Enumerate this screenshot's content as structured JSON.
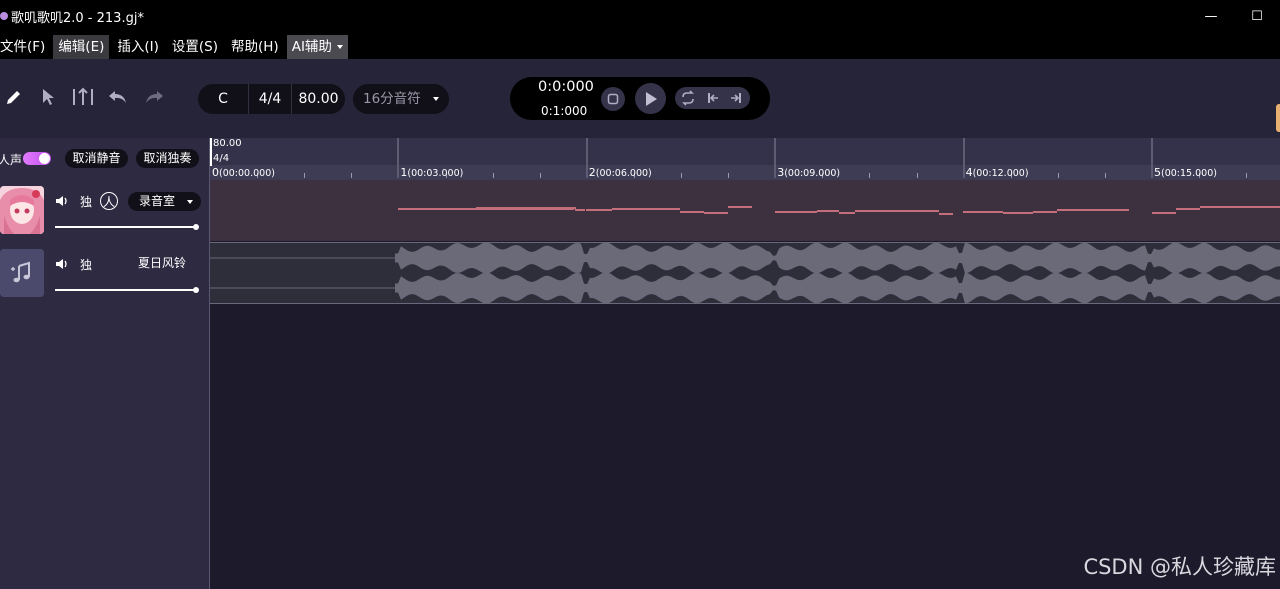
{
  "window": {
    "title": "歌叽歌叽2.0 - 213.gj*",
    "minimize": "—",
    "maximize": "☐"
  },
  "menu": {
    "items": [
      {
        "label": "文件(F)"
      },
      {
        "label": "编辑(E)"
      },
      {
        "label": "插入(I)"
      },
      {
        "label": "设置(S)"
      },
      {
        "label": "帮助(H)"
      },
      {
        "label": "AI辅助"
      }
    ]
  },
  "toolbar": {
    "key": "C",
    "time_signature": "4/4",
    "tempo": "80.00",
    "quantize": "16分音符"
  },
  "transport": {
    "position": "0:0:000",
    "bar_position": "0:1:000"
  },
  "tracks_header": {
    "voice_toggle_label": "人声",
    "unmute_all": "取消静音",
    "unsolo_all": "取消独奏"
  },
  "tracks": [
    {
      "type": "vocal",
      "solo_label": "独",
      "voice_label": "人",
      "effect": "录音室",
      "volume": 1.0
    },
    {
      "type": "audio",
      "solo_label": "独",
      "name": "夏日风铃",
      "volume": 1.0
    }
  ],
  "ruler": {
    "tempo": "80.00",
    "time_signature": "4/4",
    "bars": [
      {
        "num": "0",
        "time": "(00:00.000)"
      },
      {
        "num": "1",
        "time": "(00:03.000)"
      },
      {
        "num": "2",
        "time": "(00:06.000)"
      },
      {
        "num": "3",
        "time": "(00:09.000)"
      },
      {
        "num": "4",
        "time": "(00:12.000)"
      },
      {
        "num": "5",
        "time": "(00:15.000)"
      }
    ]
  },
  "watermark": "CSDN @私人珍藏库",
  "colors": {
    "accent": "#c04fe8",
    "note": "#c46e7a",
    "background": "#1c1a2b"
  }
}
